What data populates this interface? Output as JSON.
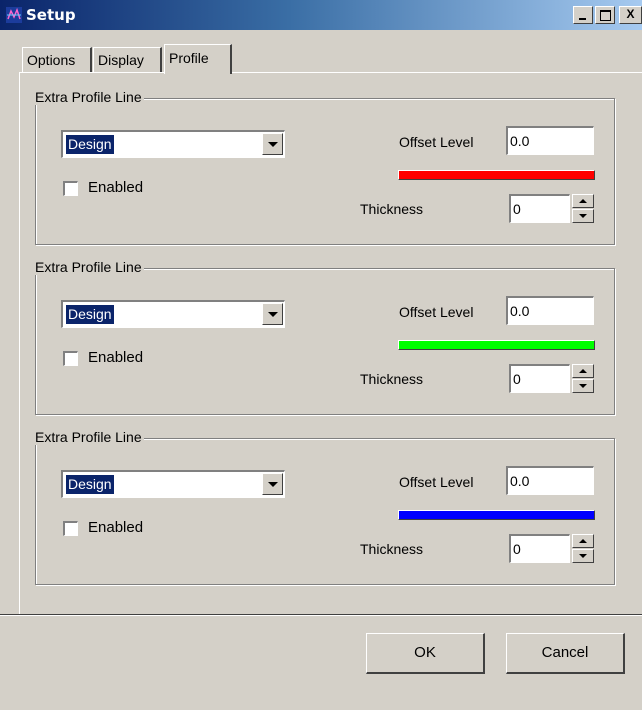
{
  "window": {
    "title": "Setup",
    "controls": {
      "minimize": "_",
      "maximize": "□",
      "close": "X"
    }
  },
  "tabs": [
    {
      "label": "Options",
      "active": false
    },
    {
      "label": "Display",
      "active": false
    },
    {
      "label": "Profile",
      "active": true
    }
  ],
  "groups": [
    {
      "legend": "Extra Profile Line",
      "combo_value": "Design",
      "enabled_label": "Enabled",
      "enabled_checked": false,
      "offset_label": "Offset Level",
      "offset_value": "0.0",
      "line_color": "#ff0000",
      "thickness_label": "Thickness",
      "thickness_value": "0"
    },
    {
      "legend": "Extra Profile Line",
      "combo_value": "Design",
      "enabled_label": "Enabled",
      "enabled_checked": false,
      "offset_label": "Offset Level",
      "offset_value": "0.0",
      "line_color": "#00ff00",
      "thickness_label": "Thickness",
      "thickness_value": "0"
    },
    {
      "legend": "Extra Profile Line",
      "combo_value": "Design",
      "enabled_label": "Enabled",
      "enabled_checked": false,
      "offset_label": "Offset Level",
      "offset_value": "0.0",
      "line_color": "#0000ff",
      "thickness_label": "Thickness",
      "thickness_value": "0"
    }
  ],
  "buttons": {
    "ok": "OK",
    "cancel": "Cancel"
  }
}
